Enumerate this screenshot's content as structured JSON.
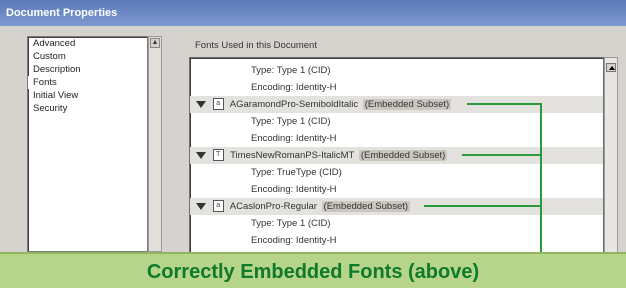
{
  "window": {
    "title": "Document Properties"
  },
  "sidebar": {
    "items": [
      {
        "label": "Advanced"
      },
      {
        "label": "Custom"
      },
      {
        "label": "Description"
      },
      {
        "label": "Fonts"
      },
      {
        "label": "Initial View"
      },
      {
        "label": "Security"
      }
    ]
  },
  "fonts_panel": {
    "label": "Fonts Used in this Document",
    "rows": [
      {
        "type": "detail",
        "text": "Type: Type 1 (CID)"
      },
      {
        "type": "detail",
        "text": "Encoding: Identity-H"
      },
      {
        "type": "font",
        "name": "AGaramondPro-SemiboldItalic",
        "status": "(Embedded Subset)"
      },
      {
        "type": "detail",
        "text": "Type: Type 1 (CID)"
      },
      {
        "type": "detail",
        "text": "Encoding: Identity-H"
      },
      {
        "type": "font",
        "name": "TimesNewRomanPS-ItalicMT",
        "status": "(Embedded Subset)"
      },
      {
        "type": "detail",
        "text": "Type: TrueType (CID)"
      },
      {
        "type": "detail",
        "text": "Encoding: Identity-H"
      },
      {
        "type": "font",
        "name": "ACaslonPro-Regular",
        "status": "(Embedded Subset)"
      },
      {
        "type": "detail",
        "text": "Type: Type 1 (CID)"
      },
      {
        "type": "detail",
        "text": "Encoding: Identity-H"
      }
    ]
  },
  "annotation": {
    "text": "Correctly Embedded Fonts (above)",
    "color": "#0f7a2a",
    "background": "#b6d58b",
    "line_color": "#2a9b38"
  },
  "icons": {
    "expand": "triangle-down-icon",
    "font_file": "font-file-icon",
    "scroll_up": "scroll-up-arrow-icon"
  }
}
